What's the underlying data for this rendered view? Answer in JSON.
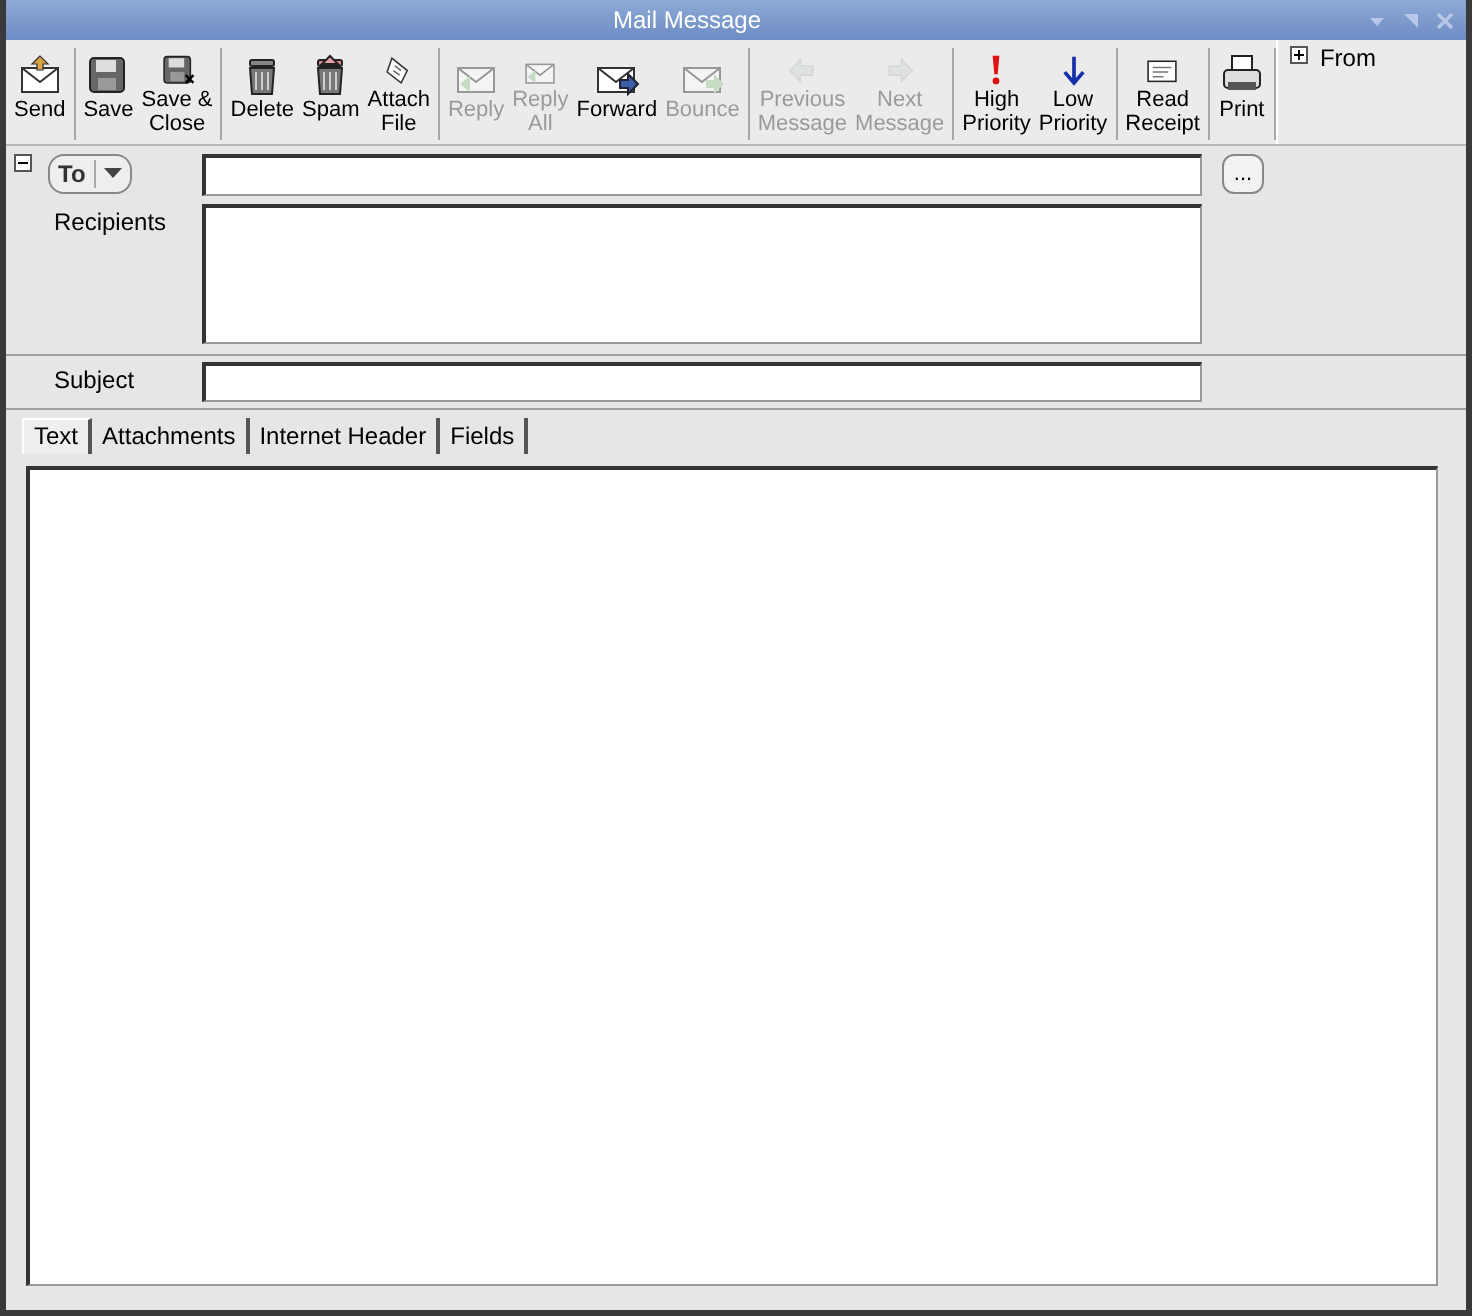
{
  "window": {
    "title": "Mail Message"
  },
  "toolbar": {
    "groups": [
      {
        "buttons": [
          {
            "label": "Send",
            "disabled": false
          }
        ]
      },
      {
        "buttons": [
          {
            "label": "Save",
            "disabled": false
          },
          {
            "label": "Save &\nClose",
            "disabled": false
          }
        ]
      },
      {
        "buttons": [
          {
            "label": "Delete",
            "disabled": false
          },
          {
            "label": "Spam",
            "disabled": false
          },
          {
            "label": "Attach\nFile",
            "disabled": false
          }
        ]
      },
      {
        "buttons": [
          {
            "label": "Reply\n",
            "disabled": true
          },
          {
            "label": "Reply\nAll",
            "disabled": true
          },
          {
            "label": "Forward",
            "disabled": false
          },
          {
            "label": "Bounce",
            "disabled": true
          }
        ]
      },
      {
        "buttons": [
          {
            "label": "Previous\nMessage",
            "disabled": true
          },
          {
            "label": "Next\nMessage",
            "disabled": true
          }
        ]
      },
      {
        "buttons": [
          {
            "label": "High\nPriority",
            "disabled": false
          },
          {
            "label": "Low\nPriority",
            "disabled": false
          }
        ]
      },
      {
        "buttons": [
          {
            "label": "Read\nReceipt",
            "disabled": false
          }
        ]
      },
      {
        "buttons": [
          {
            "label": "Print",
            "disabled": false
          }
        ]
      }
    ]
  },
  "from_panel": {
    "label": "From",
    "expanded": false
  },
  "header": {
    "expanded": true,
    "address_type": "To",
    "recipients_label": "Recipients",
    "more_button": "...",
    "subject_label": "Subject"
  },
  "tabs": [
    {
      "label": "Text",
      "selected": true
    },
    {
      "label": "Attachments",
      "selected": false
    },
    {
      "label": "Internet Header",
      "selected": false
    },
    {
      "label": "Fields",
      "selected": false
    }
  ]
}
